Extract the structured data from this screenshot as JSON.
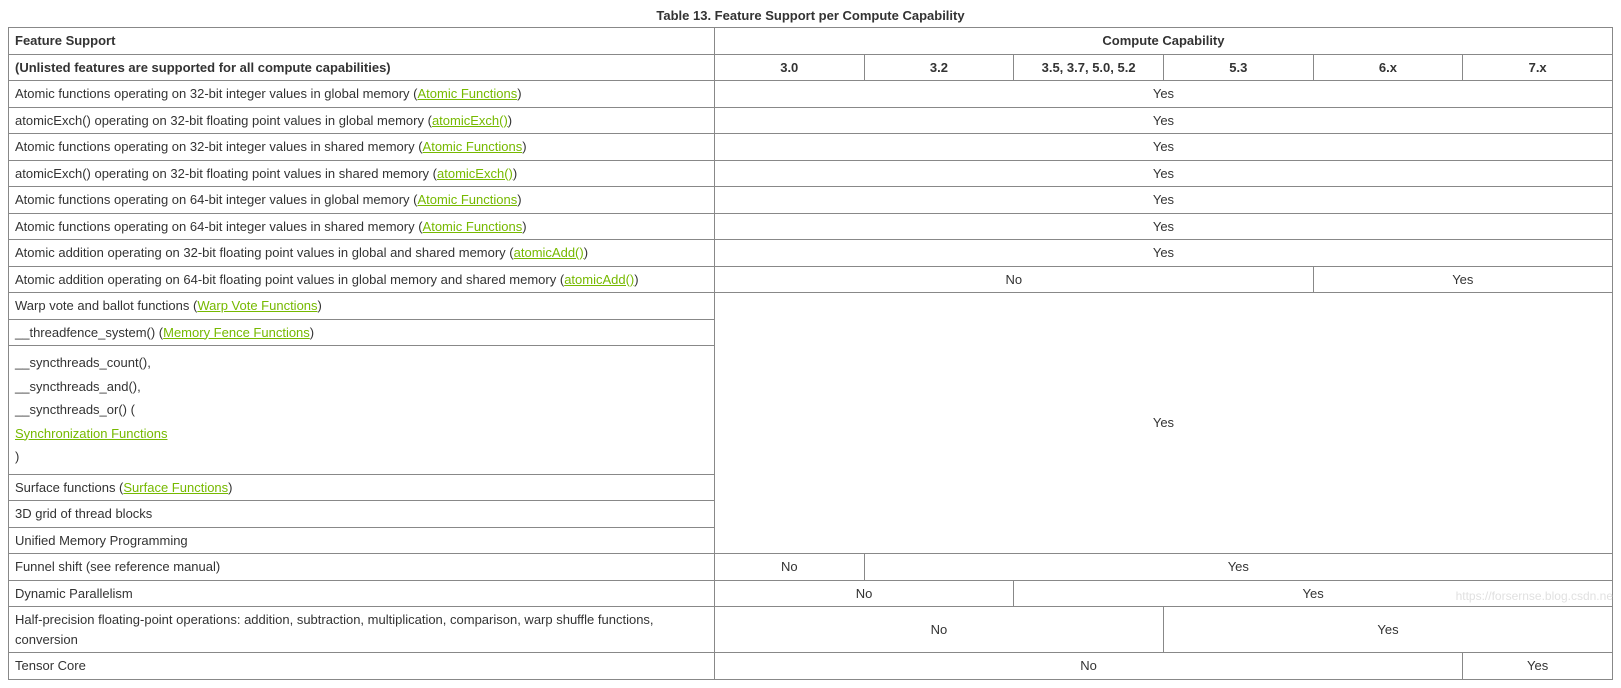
{
  "caption": "Table 13. Feature Support per Compute Capability",
  "header": {
    "feature_label": "Feature Support",
    "cc_group_label": "Compute Capability",
    "feature_sub_label": "(Unlisted features are supported for all compute capabilities)",
    "cc_cols": [
      "3.0",
      "3.2",
      "3.5, 3.7, 5.0, 5.2",
      "5.3",
      "6.x",
      "7.x"
    ]
  },
  "links": {
    "atomic_functions": "Atomic Functions",
    "atomic_exch": "atomicExch()",
    "atomic_add": "atomicAdd()",
    "warp_vote": "Warp Vote Functions",
    "mem_fence": "Memory Fence Functions",
    "sync_funcs": "Synchronization Functions",
    "surface_funcs": "Surface Functions"
  },
  "rows": {
    "r1_pre": "Atomic functions operating on 32-bit integer values in global memory (",
    "r1_post": ")",
    "r2_pre": "atomicExch() operating on 32-bit floating point values in global memory (",
    "r2_post": ")",
    "r3_pre": "Atomic functions operating on 32-bit integer values in shared memory (",
    "r3_post": ")",
    "r4_pre": "atomicExch() operating on 32-bit floating point values in shared memory (",
    "r4_post": ")",
    "r5_pre": "Atomic functions operating on 64-bit integer values in global memory (",
    "r5_post": ")",
    "r6_pre": "Atomic functions operating on 64-bit integer values in shared memory (",
    "r6_post": ")",
    "r7_pre": "Atomic addition operating on 32-bit floating point values in global and shared memory (",
    "r7_post": ")",
    "r8_pre": "Atomic addition operating on 64-bit floating point values in global memory and shared memory (",
    "r8_post": ")",
    "r9_pre": "Warp vote and ballot functions (",
    "r9_post": ")",
    "r10_pre": "__threadfence_system() (",
    "r10_post": ")",
    "r11a": "__syncthreads_count(),",
    "r11b": "__syncthreads_and(),",
    "r11c_pre": "__syncthreads_or() (",
    "r11c_post": ")",
    "r12_pre": "Surface functions (",
    "r12_post": ")",
    "r13": "3D grid of thread blocks",
    "r14": "Unified Memory Programming",
    "r15": "Funnel shift (see reference manual)",
    "r16": "Dynamic Parallelism",
    "r17": "Half-precision floating-point operations: addition, subtraction, multiplication, comparison, warp shuffle functions, conversion",
    "r18": "Tensor Core"
  },
  "vals": {
    "yes": "Yes",
    "no": "No"
  },
  "watermark": "https://forsernse.blog.csdn.ne"
}
